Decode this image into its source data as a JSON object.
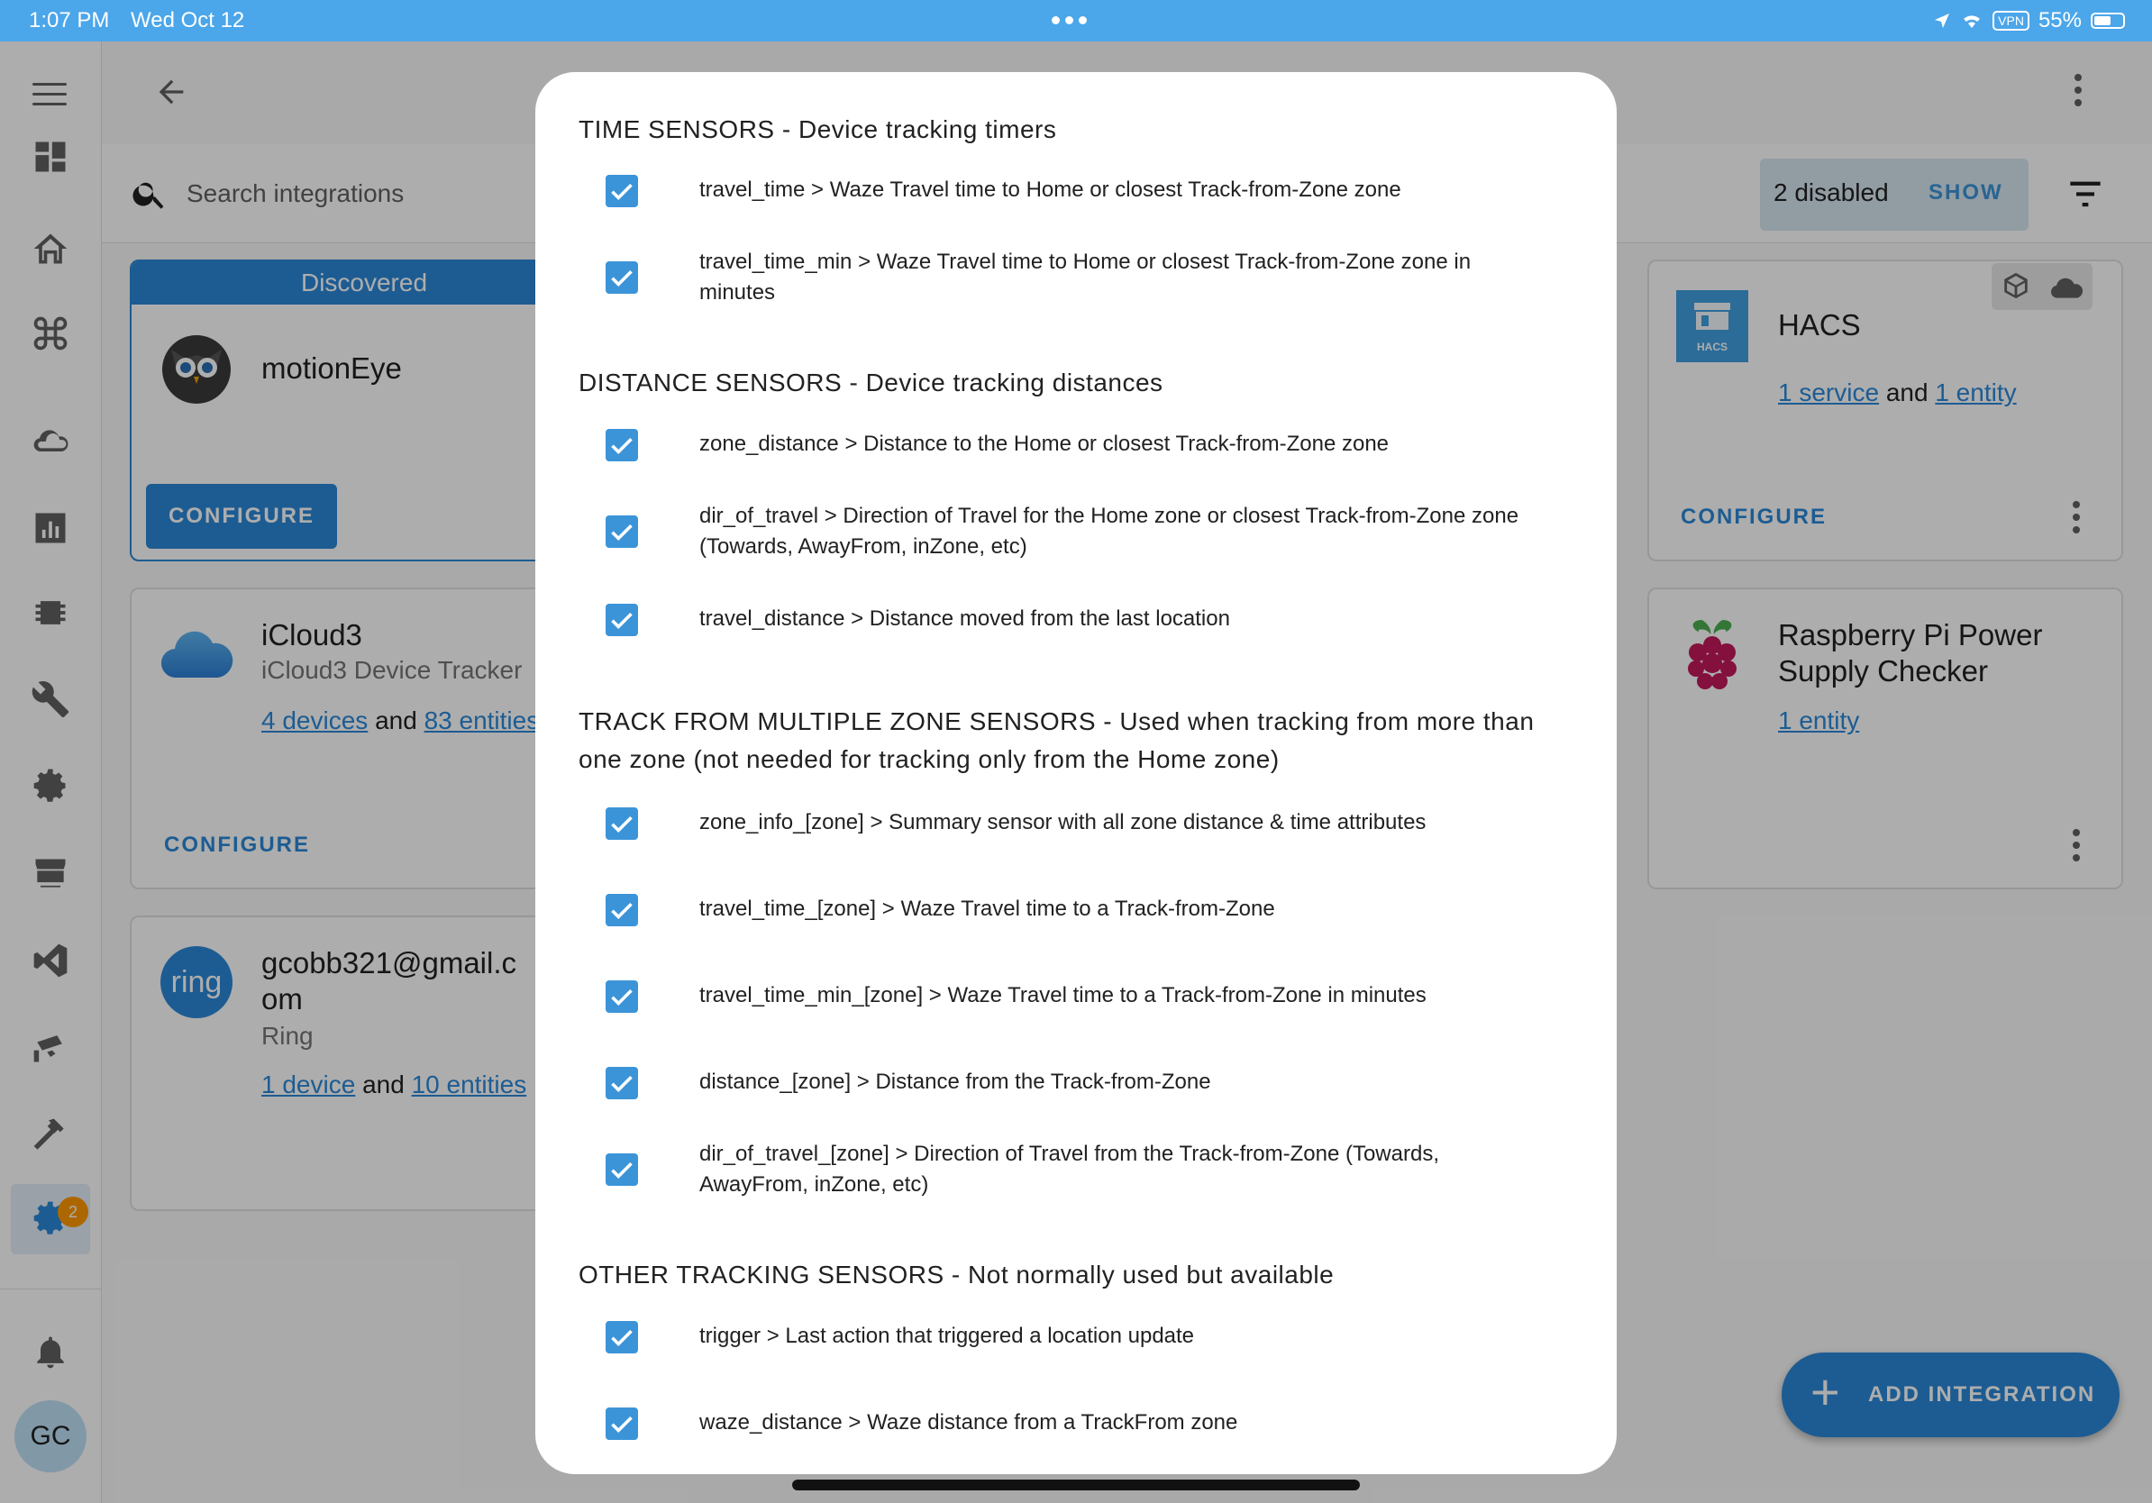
{
  "status_bar": {
    "time": "1:07 PM",
    "date": "Wed Oct 12",
    "vpn": "VPN",
    "battery": "55%"
  },
  "sidebar": {
    "badge": "2",
    "avatar": "GC",
    "icons": [
      "menu-icon",
      "overview-icon",
      "home-icon",
      "command-icon",
      "cloud-icon",
      "history-icon",
      "chip-icon",
      "wrench-icon",
      "cog-icon",
      "hacs-icon",
      "vscode-icon",
      "camera-icon",
      "hammer-icon",
      "settings-icon",
      "bell-icon"
    ]
  },
  "search": {
    "placeholder": "Search integrations"
  },
  "filters": {
    "disabled_text": "2 disabled",
    "show_label": "SHOW"
  },
  "cards": {
    "discovered": {
      "header": "Discovered",
      "title": "motionEye",
      "configure": "CONFIGURE"
    },
    "icloud": {
      "title": "iCloud3",
      "subtitle": "iCloud3 Device Tracker",
      "devices": "4 devices",
      "and": "and",
      "entities": "83 entities",
      "configure": "CONFIGURE"
    },
    "ring": {
      "title_line1": "gcobb321@gmail.c",
      "title_line2": "om",
      "subtitle": "Ring",
      "logo_text": "ring",
      "devices": "1 device",
      "and": "and",
      "entities": "10 entities"
    },
    "hacs": {
      "title": "HACS",
      "logo_text": "HACS",
      "services": "1 service",
      "and": "and",
      "entities": "1 entity",
      "configure": "CONFIGURE"
    },
    "rpi": {
      "title_line1": "Raspberry Pi Power",
      "title_line2": "Supply Checker",
      "entities": "1 entity"
    }
  },
  "fab": {
    "plus": "+",
    "label": "ADD INTEGRATION"
  },
  "dialog": {
    "sections": [
      {
        "title": "TIME SENSORS - Device tracking timers",
        "options": [
          "travel_time > Waze Travel time to Home or closest Track-from-Zone zone",
          "travel_time_min > Waze Travel time to Home or closest Track-from-Zone zone in minutes"
        ]
      },
      {
        "title": "DISTANCE SENSORS - Device tracking distances",
        "options": [
          "zone_distance > Distance to the Home or closest Track-from-Zone zone",
          "dir_of_travel > Direction of Travel for the Home zone or closest Track-from-Zone zone (Towards, AwayFrom, inZone, etc)",
          "travel_distance > Distance moved from the last location"
        ]
      },
      {
        "title": "TRACK FROM MULTIPLE ZONE SENSORS - Used when tracking from more than one zone (not needed for tracking only from the Home zone)",
        "options": [
          "zone_info_[zone] > Summary sensor with all zone distance & time attributes",
          "travel_time_[zone] > Waze Travel time to a Track-from-Zone",
          "travel_time_min_[zone] > Waze Travel time to a Track-from-Zone in minutes",
          "distance_[zone] > Distance from the Track-from-Zone",
          "dir_of_travel_[zone] > Direction of Travel from the Track-from-Zone (Towards, AwayFrom, inZone, etc)"
        ]
      },
      {
        "title": "OTHER TRACKING SENSORS - Not normally used but available",
        "options": [
          "trigger > Last action that triggered a location update",
          "waze_distance > Waze distance from a TrackFrom zone"
        ]
      }
    ]
  }
}
